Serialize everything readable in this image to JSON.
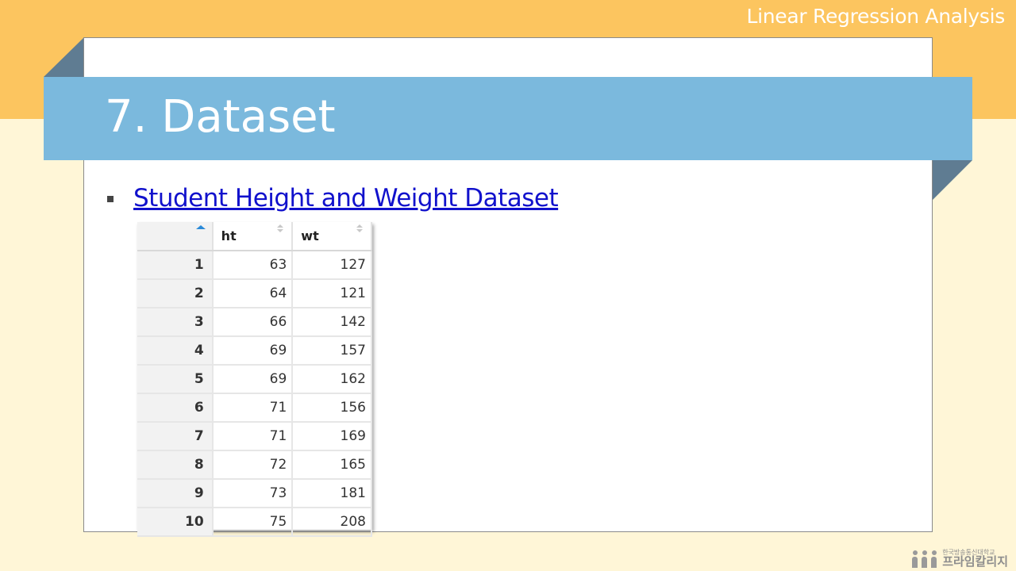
{
  "header": {
    "title": "Linear Regression Analysis"
  },
  "slide": {
    "title": "7. Dataset",
    "bullet": {
      "link_text": "Student Height and Weight Dataset"
    }
  },
  "table": {
    "columns": [
      "",
      "ht",
      "wt"
    ],
    "rows": [
      [
        "1",
        "63",
        "127"
      ],
      [
        "2",
        "64",
        "121"
      ],
      [
        "3",
        "66",
        "142"
      ],
      [
        "4",
        "69",
        "157"
      ],
      [
        "5",
        "69",
        "162"
      ],
      [
        "6",
        "71",
        "156"
      ],
      [
        "7",
        "71",
        "169"
      ],
      [
        "8",
        "72",
        "165"
      ],
      [
        "9",
        "73",
        "181"
      ],
      [
        "10",
        "75",
        "208"
      ]
    ]
  },
  "footer": {
    "logo_small": "한국방송통신대학교",
    "logo_big": "프라임칼리지"
  },
  "colors": {
    "top_band": "#fcc55f",
    "bottom_band": "#fff6d7",
    "title_band": "#7bb9dd",
    "fold": "#5f7c92",
    "link": "#1111cc",
    "sort_active": "#2b8ad8"
  },
  "icons": {
    "bullet": "square-bullet-icon",
    "sort_index": "sort-ascending-icon",
    "sort_columns": "sort-both-icon",
    "logo": "people-logo-icon"
  }
}
